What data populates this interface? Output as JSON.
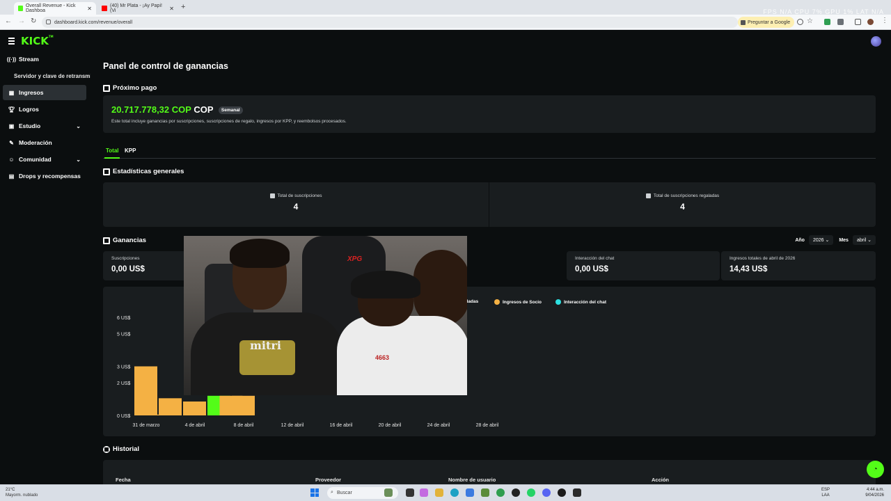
{
  "browser": {
    "tabs": [
      {
        "title": "Overall Revenue - Kick Dashboa",
        "active": true,
        "favicon_color": "#53fc18"
      },
      {
        "title": "(40) Mr Plata - ¡Ay Papi! (Vi",
        "active": false,
        "favicon_color": "#ff0000"
      }
    ],
    "new_tab": "+",
    "system_stats": "FPS N/A  CPU 7%  GPU 1%  LAT N/A",
    "url": "dashboard.kick.com/revenue/overall",
    "google_button": "Preguntar a Google"
  },
  "app": {
    "logo": "KICK",
    "logo_tm": "TM",
    "accent_color": "#53fc18"
  },
  "sidebar": {
    "items": [
      {
        "label": "Stream",
        "icon": "broadcast-icon"
      },
      {
        "label": "Ingresos",
        "icon": "chart-icon",
        "active": true
      },
      {
        "label": "Logros",
        "icon": "trophy-icon"
      },
      {
        "label": "Estudio",
        "icon": "studio-icon",
        "expandable": true
      },
      {
        "label": "Moderación",
        "icon": "wrench-icon"
      },
      {
        "label": "Comunidad",
        "icon": "people-icon",
        "expandable": true
      },
      {
        "label": "Drops y recompensas",
        "icon": "gift-icon"
      }
    ],
    "sub_item": "Servidor y clave de retransmisión"
  },
  "main": {
    "page_title": "Panel de control de ganancias",
    "next_payout": {
      "section_title": "Próximo pago",
      "amount": "20.717.778,32 COP",
      "currency": "COP",
      "badge": "Semanal",
      "note": "Este total incluye ganancias por suscripciones, suscripciones de regalo, ingresos por KPP, y reembolsos procesados."
    },
    "tabs": [
      "Total",
      "KPP"
    ],
    "general_stats": {
      "section_title": "Estadísticas generales",
      "cells": [
        {
          "label": "Total de suscripciones",
          "value": "4"
        },
        {
          "label": "Total de suscripciones regaladas",
          "value": "4"
        }
      ]
    },
    "earnings": {
      "section_title": "Ganancias",
      "year_label": "Año",
      "year_value": "2026",
      "month_label": "Mes",
      "month_value": "abril",
      "metrics": [
        {
          "label": "Suscripciones",
          "value": "0,00 US$"
        },
        {
          "label": "Interacción del chat",
          "value": "0,00 US$"
        },
        {
          "label": "Ingresos totales de abril de 2026",
          "value": "14,43 US$"
        }
      ],
      "legend": [
        {
          "name": "galadas",
          "color": "#53fc18"
        },
        {
          "name": "Ingresos de Socio",
          "color": "#f4b144"
        },
        {
          "name": "Interacción del chat",
          "color": "#2de0e0"
        }
      ]
    },
    "history": {
      "section_title": "Historial",
      "columns": [
        "Fecha",
        "Proveedor",
        "Nombre de usuario",
        "Acción"
      ]
    }
  },
  "chart_data": {
    "type": "bar",
    "y_ticks": [
      "0 US$",
      "2 US$",
      "3 US$",
      "5 US$",
      "6 US$"
    ],
    "x_ticks": [
      "31 de marzo",
      "4 de abril",
      "8 de abril",
      "12 de abril",
      "16 de abril",
      "20 de abril",
      "24 de abril",
      "28 de abril"
    ],
    "ylim": [
      0,
      6
    ],
    "bars": [
      {
        "day": "31 de marzo",
        "value": 3.0,
        "color": "#f4b144"
      },
      {
        "day": "1 de abril",
        "value": 0.05,
        "color": "#f4b144"
      },
      {
        "day": "2 de abril",
        "value": 1.05,
        "color": "#f4b144"
      },
      {
        "day": "4 de abril",
        "value": 0.85,
        "color": "#f4b144"
      },
      {
        "day": "6 de abril",
        "value": 1.2,
        "color": "#53fc18"
      },
      {
        "day": "7 de abril",
        "value": 1.2,
        "color": "#f4b144"
      },
      {
        "day": "8 de abril",
        "value": 1.2,
        "color": "#f4b144"
      }
    ]
  },
  "taskbar": {
    "weather_temp": "21°C",
    "weather_desc": "Mayorm. nublado",
    "search_placeholder": "Buscar",
    "lang_top": "ESP",
    "lang_bottom": "LAA",
    "time": "4:44 a.m.",
    "date": "9/04/2026"
  }
}
